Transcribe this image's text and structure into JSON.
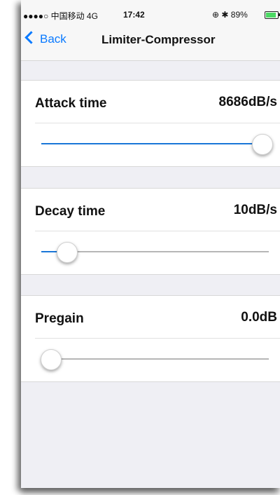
{
  "status_bar": {
    "carrier": "●●●●○ 中国移动  4G",
    "time": "17:42",
    "right": "⊕ ✱ 89%",
    "battery_level": 0.89
  },
  "nav": {
    "back_label": "Back",
    "title": "Limiter-Compressor"
  },
  "settings": [
    {
      "label": "Attack time",
      "value": "8686dB/s",
      "slider_level": 0.97
    },
    {
      "label": "Decay time",
      "value": "10dB/s",
      "slider_level": 0.11
    },
    {
      "label": "Pregain",
      "value": "0.0dB",
      "slider_level": 0.04
    }
  ],
  "colors": {
    "accent": "#1a77d8",
    "back": "#0a7aff",
    "battery": "#4cd964"
  }
}
